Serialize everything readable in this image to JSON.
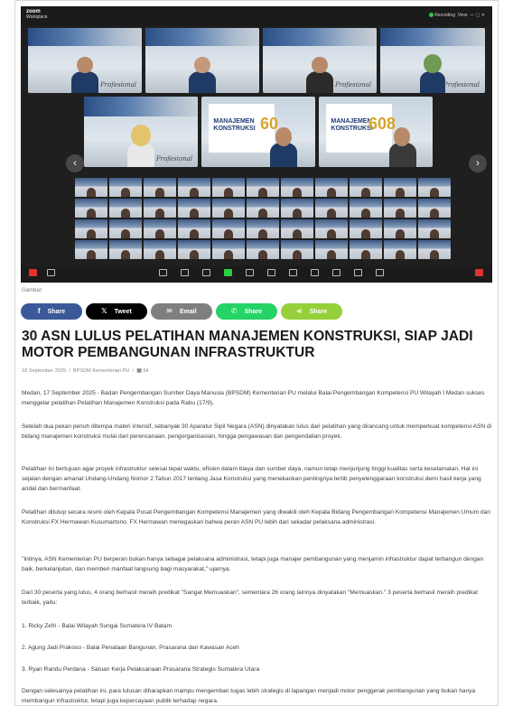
{
  "zoom": {
    "app_name": "zoom",
    "app_sub": "Workplace",
    "status_text": "Recording",
    "view_label": "View",
    "tile_signature": "Profesional"
  },
  "caption_label": "Gambar:",
  "share": {
    "facebook": "Share",
    "twitter": "Tweet",
    "email": "Email",
    "whatsapp": "Share",
    "sharethis": "Share",
    "colors": {
      "facebook": "#3b5998",
      "twitter": "#000000",
      "email": "#7f7f7f",
      "whatsapp": "#25d366",
      "sharethis": "#95d03a"
    }
  },
  "article": {
    "title": "30 ASN LULUS PELATIHAN MANAJEMEN KONSTRUKSI, SIAP JADI MOTOR PEMBANGUNAN INFRASTRUKTUR",
    "date": "18 September 2025",
    "author": "BPSDM Kementerian PU",
    "views": "64",
    "paragraphs": [
      "Medan, 17 September 2025 - Badan Pengembangan Sumber Daya Manusia (BPSDM) Kementerian PU melalui Balai Pengembangan Kompetensi PU Wilayah I Medan sukses menggelar pelatihan Pelatihan Manajemen Konstruksi pada Rabu (17/9).",
      "Setelah dua pekan penuh ditempa materi intensif, sebanyak 30 Aparatur Sipil Negara (ASN) dinyatakan lulus dari pelatihan yang dirancang untuk memperkuat kompetensi ASN di bidang manajemen konstruksi mulai dari perencanaan, pengorganisasian, hingga pengawasan dan pengendalian proyek.",
      "Pelatihan ini bertujuan agar proyek infrastruktur selesai tepat waktu, efisien dalam biaya dan sumber daya, namun tetap menjunjung tinggi kualitas serta keselamatan. Hal ini sejalan dengan amanat Undang-Undang Nomor 2 Tahun 2017 tentang Jasa Konstruksi yang menekankan pentingnya tertib penyelenggaraan konstruksi demi hasil kerja yang andal dan bermanfaat.",
      "Pelatihan ditutup secara resmi oleh Kepala Pusat Pengembangan Kompetensi Manajemen yang diwakili oleh Kepala Bidang Pengembangan Kompetensi Manajemen Umum dan Konstruksi FX Hermawan Kusumartono. FX Hermawan menegaskan bahwa peran ASN PU lebih dari sekadar pelaksana administrasi.",
      "\"Intinya, ASN Kementerian PU berperan bukan hanya sebagai pelaksana administrasi, tetapi juga manajer pembangunan yang menjamin infrastruktur dapat terbangun dengan baik, berkelanjutan, dan memberi manfaat langsung bagi masyarakat,\" ujarnya.",
      "Dari 30 peserta yang lulus, 4 orang berhasil meraih predikat \"Sangat Memuaskan\", sementara 26 orang lainnya dinyatakan \"Memuaskan.\" 3 peserta berhasil meraih predikat terbaik, yaitu:",
      "1. Ricky Zefri - Balai Wilayah Sungai Sumatera IV Batam",
      "2. Agung Jadi Prakoso - Balai Penataan Bangunan, Prasarana dan Kawasan Aceh",
      "3. Ryan Randu Perdana - Satuan Kerja Pelaksanaan Prasarana Strategis Sumatera Utara",
      "Dengan selesainya pelatihan ini, para lulusan diharapkan mampu mengemban tugas lebih strategis di lapangan menjadi motor penggerak pembangunan yang bukan hanya membangun infrastruktur, tetapi juga kepercayaan publik terhadap negara."
    ]
  }
}
